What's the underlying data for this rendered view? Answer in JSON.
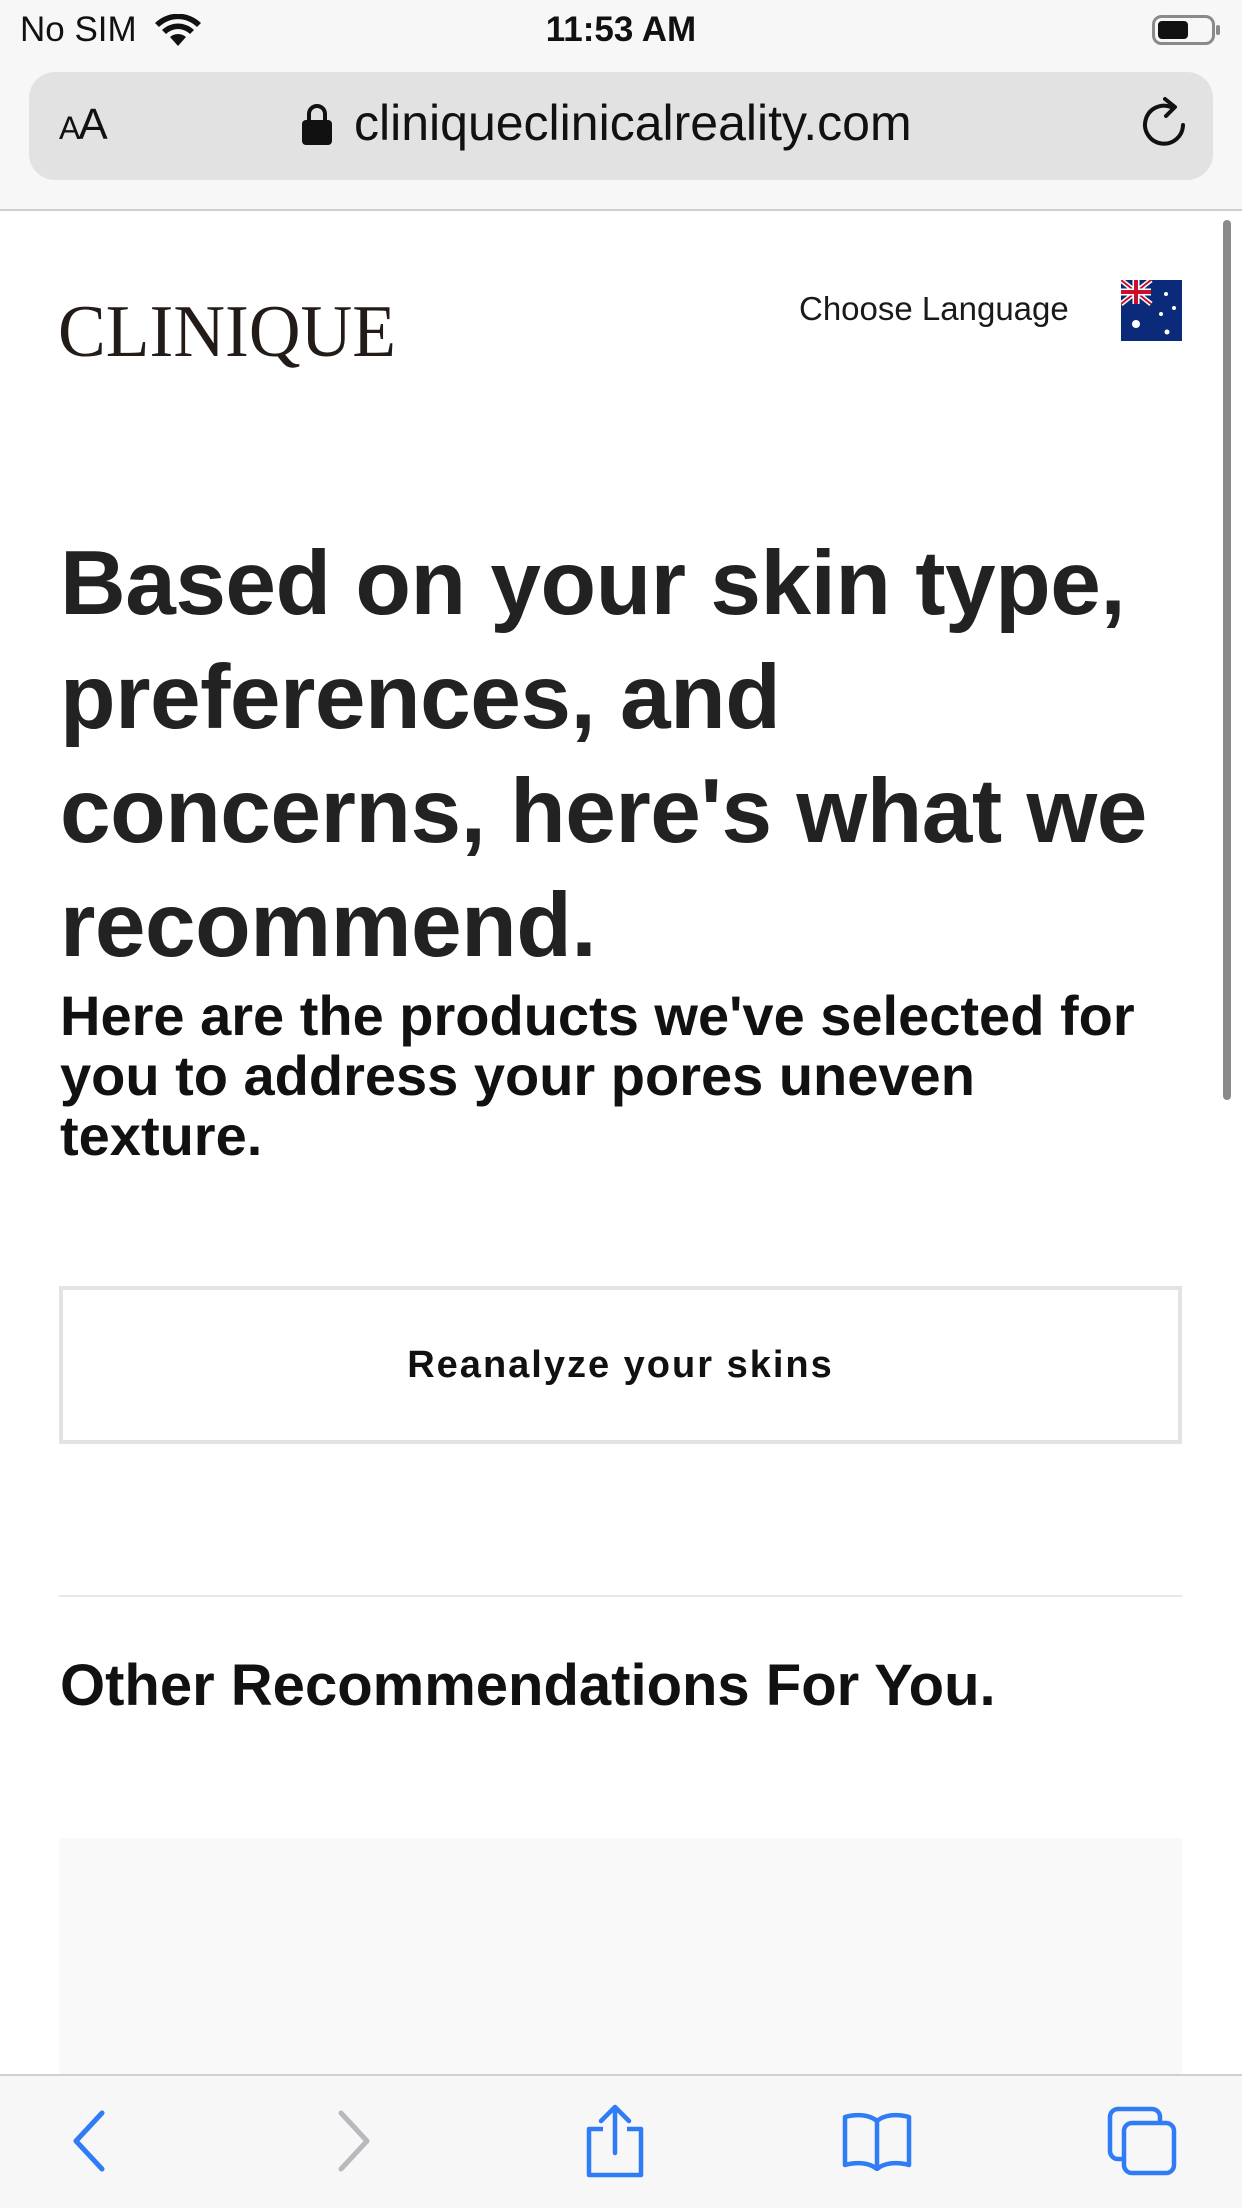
{
  "status_bar": {
    "carrier": "No SIM",
    "time": "11:53 AM",
    "wifi_icon": "wifi-icon",
    "battery_icon": "battery-icon"
  },
  "browser": {
    "text_size_small": "A",
    "text_size_large": "A",
    "url": "cliniqueclinicalreality.com",
    "lock_icon": "lock-icon",
    "reload_icon": "reload-icon",
    "accent_color": "#2f7cf6"
  },
  "header": {
    "logo_text": "CLINIQUE",
    "choose_language": "Choose Language",
    "flag_icon": "australia-flag-icon"
  },
  "main": {
    "headline": "Based on your skin type, preferences, and concerns, here's what we recommend.",
    "subheadline": "Here are the products we've selected for you to address your pores uneven texture.",
    "reanalyze_label": "Reanalyze your skins",
    "other_title": "Other Recommendations For You."
  },
  "toolbar": {
    "back_icon": "back-chevron-icon",
    "forward_icon": "forward-chevron-icon",
    "share_icon": "share-icon",
    "bookmarks_icon": "bookmarks-icon",
    "tabs_icon": "tabs-icon"
  }
}
